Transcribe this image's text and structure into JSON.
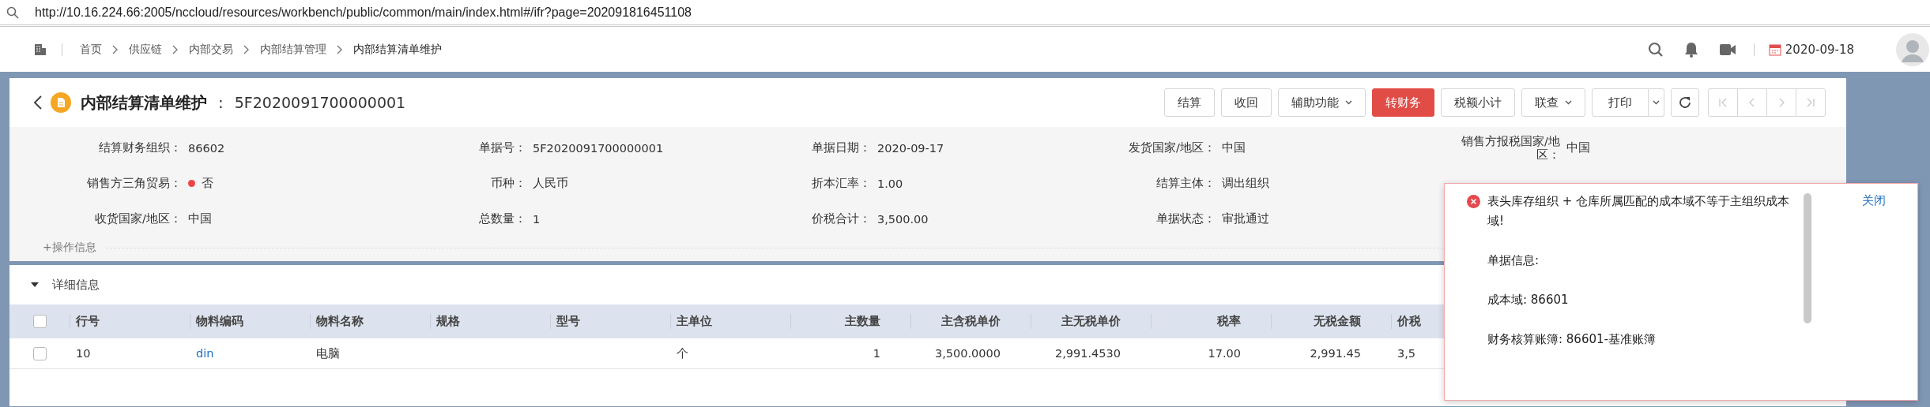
{
  "address_bar": {
    "url": "http://10.16.224.66:2005/nccloud/resources/workbench/public/common/main/index.html#/ifr?page=202091816451108"
  },
  "top_nav": {
    "breadcrumbs": [
      {
        "label": "首页",
        "current": false
      },
      {
        "label": "供应链",
        "current": false
      },
      {
        "label": "内部交易",
        "current": false
      },
      {
        "label": "内部结算管理",
        "current": false
      },
      {
        "label": "内部结算清单维护",
        "current": true
      }
    ],
    "date": "2020-09-18"
  },
  "header": {
    "title": "内部结算清单维护",
    "separator": ":",
    "code": "5F2020091700000001"
  },
  "toolbar": {
    "buttons": [
      {
        "label": "结算",
        "kind": "plain"
      },
      {
        "label": "收回",
        "kind": "plain"
      },
      {
        "label": "辅助功能",
        "kind": "dropdown"
      },
      {
        "label": "转财务",
        "kind": "primary"
      },
      {
        "label": "税额小计",
        "kind": "plain"
      },
      {
        "label": "联查",
        "kind": "dropdown"
      },
      {
        "label": "打印",
        "kind": "split"
      }
    ],
    "pager_disabled": true
  },
  "form": {
    "rows": [
      [
        {
          "label": "结算财务组织：",
          "value": "86602",
          "kind": "text"
        },
        {
          "label": "单据号：",
          "value": "5F2020091700000001",
          "kind": "text"
        },
        {
          "label": "单据日期：",
          "value": "2020-09-17",
          "kind": "text"
        },
        {
          "label": "发货国家/地区：",
          "value": "中国",
          "kind": "text"
        },
        {
          "label": "销售方报税国家/地区：",
          "value": "中国",
          "kind": "text"
        }
      ],
      [
        {
          "label": "销售方三角贸易：",
          "value": "否",
          "kind": "flag"
        },
        {
          "label": "币种：",
          "value": "人民币",
          "kind": "text"
        },
        {
          "label": "折本汇率：",
          "value": "1.00",
          "kind": "text"
        },
        {
          "label": "结算主体：",
          "value": "调出组织",
          "kind": "text"
        }
      ],
      [
        {
          "label": "收货国家/地区：",
          "value": "中国",
          "kind": "text"
        },
        {
          "label": "总数量：",
          "value": "1",
          "kind": "text"
        },
        {
          "label": "价税合计：",
          "value": "3,500.00",
          "kind": "text"
        },
        {
          "label": "单据状态：",
          "value": "审批通过",
          "kind": "text"
        }
      ]
    ],
    "more_link": "+操作信息"
  },
  "detail": {
    "title": "详细信息",
    "expanded": true,
    "all_selected": false,
    "columns": [
      {
        "label": "行号",
        "kind": "text"
      },
      {
        "label": "物料编码",
        "kind": "link"
      },
      {
        "label": "物料名称",
        "kind": "text"
      },
      {
        "label": "规格",
        "kind": "text"
      },
      {
        "label": "型号",
        "kind": "text"
      },
      {
        "label": "主单位",
        "kind": "text"
      },
      {
        "label": "主数量",
        "kind": "number"
      },
      {
        "label": "主含税单价",
        "kind": "number"
      },
      {
        "label": "主无税单价",
        "kind": "number"
      },
      {
        "label": "税率",
        "kind": "number"
      },
      {
        "label": "无税金额",
        "kind": "number"
      },
      {
        "label": "价税",
        "kind": "text"
      }
    ],
    "rows": [
      {
        "selected": false,
        "cells": [
          "10",
          "din",
          "电脑",
          null,
          null,
          "个",
          "1",
          "3,500.0000",
          "2,991.4530",
          "17.00",
          "2,991.45",
          "3,5"
        ]
      }
    ]
  },
  "alert": {
    "kind": "error",
    "message": "表头库存组织 + 仓库所属匹配的成本域不等于主组织成本域!",
    "lines": [
      "单据信息:",
      "成本域: 86601",
      "财务核算账簿: 86601-基准账簿"
    ],
    "close": "关闭"
  }
}
